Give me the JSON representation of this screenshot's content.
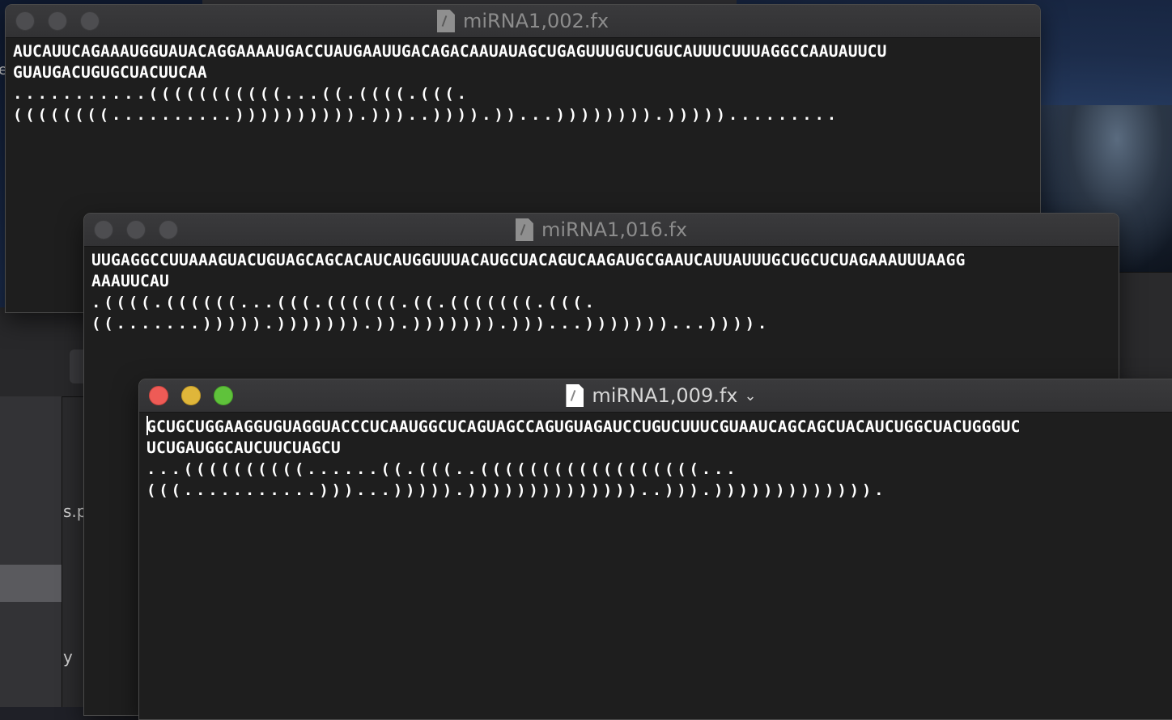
{
  "background": {
    "partial_text_left": "s.p",
    "partial_text_left2": "y",
    "stray_char": "e"
  },
  "windows": [
    {
      "title": "miRNA1,002.fx",
      "sequence": "AUCAUUCAGAAAUGGUAUACAGGAAAAUGACCUAUGAAUUGACAGACAAUAUAGCUGAGUUUGUCUGUCAUUUCUUUAGGCCAAUAUUCUGUAUGACUGUGCUACUUCAA",
      "sequence_line1": "AUCAUUCAGAAAUGGUAUACAGGAAAAUGACCUAUGAAUUGACAGACAAUAUAGCUGAGUUUGUCUGUCAUUUCUUUAGGCCAAUAUUCU",
      "sequence_line2": "GUAUGACUGUGCUACUUCAA",
      "structure_line1": "...........(((((((((((...((.((((.(((.",
      "structure_line2": "((((((((..........)))))))))).)))..)))).))...)))))))).))))).........",
      "active": false
    },
    {
      "title": "miRNA1,016.fx",
      "sequence_line1": "UUGAGGCCUUAAAGUACUGUAGCAGCACAUCAUGGUUUACAUGCUACAGUCAAGAUGCGAAUCAUUAUUUGCUGCUCUAGAAAUUUAAGG",
      "sequence_line2": "AAAUUCAU",
      "structure_line1": ".((((.((((((...(((.((((((.((.(((((((.(((.",
      "structure_line2": "((.......))))).))))))).)).))))))).)))...)))))))...)))).",
      "active": false
    },
    {
      "title": "miRNA1,009.fx",
      "sequence_line1": "GCUGCUGGAAGGUGUAGGUACCCUCAAUGGCUCAGUAGCCAGUGUAGAUCCUGUCUUUCGUAAUCAGCAGCUACAUCUGGCUACUGGGUC",
      "sequence_line2": "UCUGAUGGCAUCUUCUAGCU",
      "structure_line1": "...((((((((((......((.(((..((((((((((((((((((...",
      "structure_line2": "(((...........)))...))))).))))))))))))))..))).))))))))))))).",
      "active": true
    }
  ]
}
